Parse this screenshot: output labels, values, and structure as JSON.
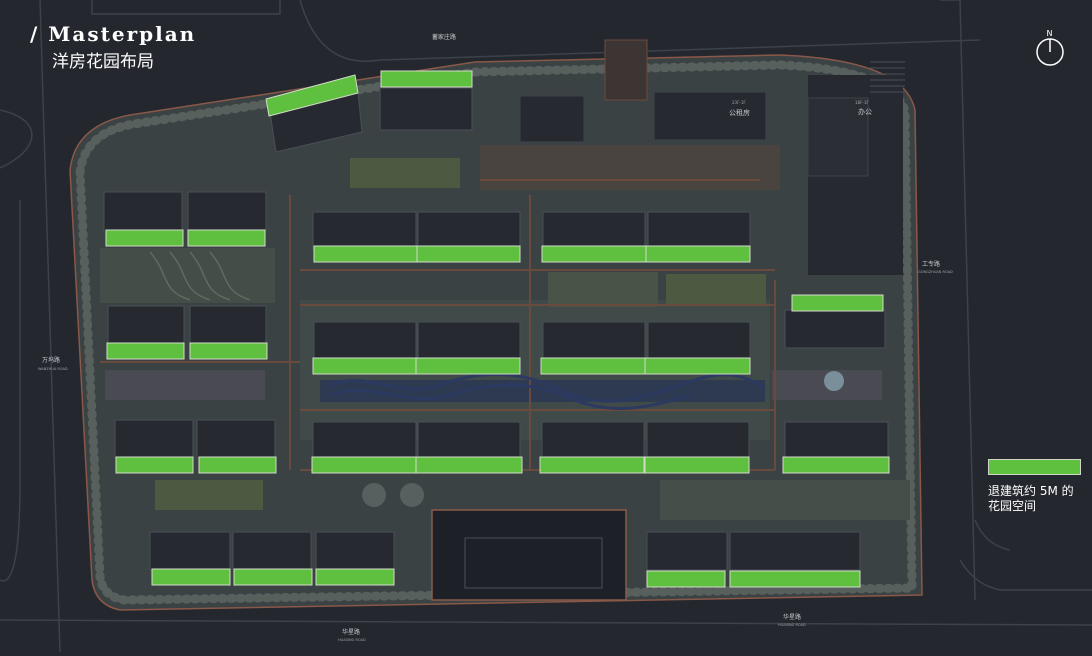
{
  "title": {
    "main": "/ Masterplan",
    "sub": "洋房花园布局"
  },
  "compass": {
    "label": "N"
  },
  "legend": {
    "color": "#5fbf3f",
    "line1": "退建筑约 5M 的",
    "line2": "花园空间"
  },
  "roads": {
    "north": "蓄家庄路",
    "west": "万坞路",
    "west_en": "WANZHUA ROAD",
    "east": "工专路",
    "east_en": "GONGZHUAN ROAD",
    "south_left": "华星路",
    "south_left_en": "HUAXING ROAD",
    "south_right": "华星路",
    "south_right_en": "HUAXING ROAD"
  },
  "labels": {
    "public_space": "公租房",
    "office": "办公",
    "public_floors": "23F-1F",
    "office_floors": "18F-1F"
  },
  "colors": {
    "green": "#5fbf3f",
    "building": "#262a30",
    "site": "#3b4446"
  }
}
